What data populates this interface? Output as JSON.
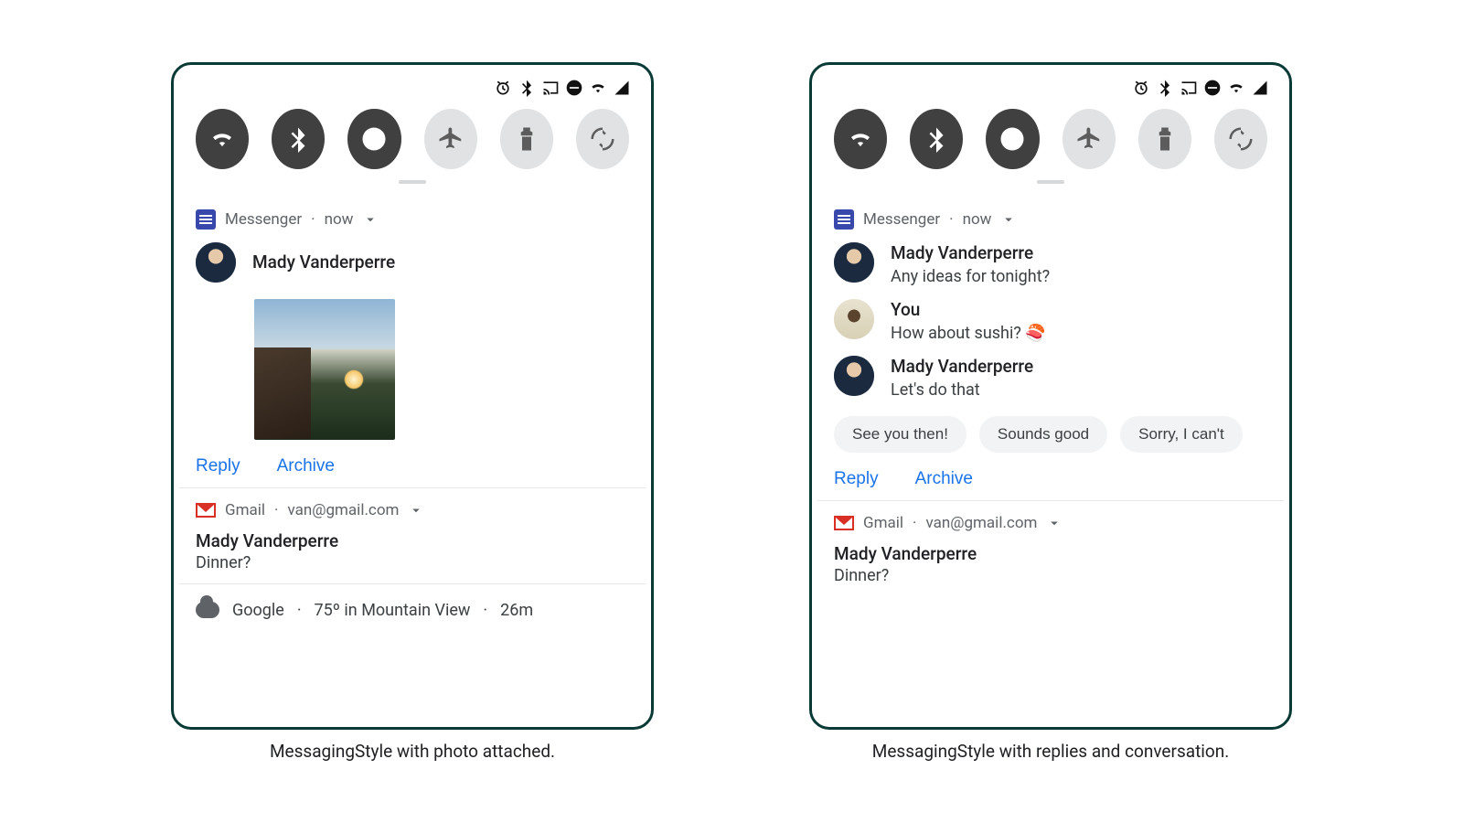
{
  "status_icons": [
    "alarm-icon",
    "bluetooth-icon",
    "cast-icon",
    "dnd-icon",
    "wifi-icon",
    "signal-icon"
  ],
  "qs": {
    "toggles": [
      {
        "name": "wifi-toggle",
        "icon": "wifi",
        "state": "on"
      },
      {
        "name": "bluetooth-toggle",
        "icon": "bluetooth",
        "state": "on"
      },
      {
        "name": "dnd-toggle",
        "icon": "dnd",
        "state": "on"
      },
      {
        "name": "airplane-toggle",
        "icon": "airplane",
        "state": "off"
      },
      {
        "name": "flashlight-toggle",
        "icon": "flashlight",
        "state": "off"
      },
      {
        "name": "rotate-toggle",
        "icon": "rotate",
        "state": "off"
      }
    ]
  },
  "left": {
    "messenger": {
      "app": "Messenger",
      "time": "now",
      "sender": "Mady Vanderperre",
      "has_photo": true,
      "actions": {
        "reply": "Reply",
        "archive": "Archive"
      }
    },
    "gmail": {
      "app": "Gmail",
      "account": "van@gmail.com",
      "sender": "Mady Vanderperre",
      "subject": "Dinner?"
    },
    "weather": {
      "app": "Google",
      "summary": "75º in Mountain View",
      "age": "26m"
    },
    "caption": "MessagingStyle with photo attached."
  },
  "right": {
    "messenger": {
      "app": "Messenger",
      "time": "now",
      "thread": [
        {
          "sender": "Mady Vanderperre",
          "text": "Any ideas for tonight?",
          "avatar": "mady"
        },
        {
          "sender": "You",
          "text": "How about sushi? 🍣",
          "avatar": "you"
        },
        {
          "sender": "Mady Vanderperre",
          "text": "Let's do that",
          "avatar": "mady"
        }
      ],
      "smart_replies": [
        "See you then!",
        "Sounds good",
        "Sorry, I can't"
      ],
      "actions": {
        "reply": "Reply",
        "archive": "Archive"
      }
    },
    "gmail": {
      "app": "Gmail",
      "account": "van@gmail.com",
      "sender": "Mady Vanderperre",
      "subject": "Dinner?"
    },
    "caption": "MessagingStyle with replies and conversation."
  }
}
